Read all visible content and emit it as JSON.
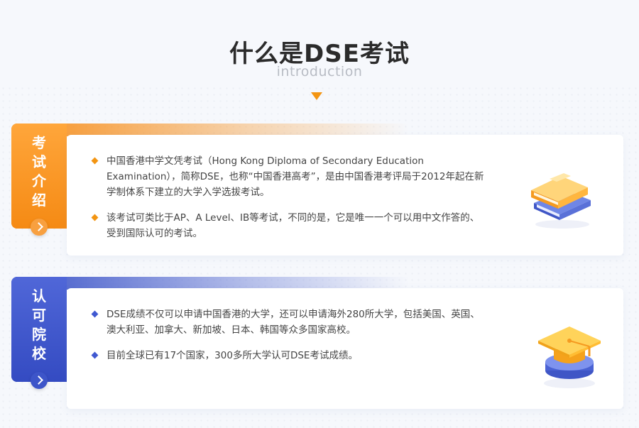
{
  "header": {
    "title": "什么是DSE考试",
    "subtitle": "introduction"
  },
  "sections": [
    {
      "tab_chars": [
        "考",
        "试",
        "介",
        "绍"
      ],
      "bullets": [
        "中国香港中学文凭考试（Hong Kong Diploma of Secondary Education Examination），简称DSE，也称“中国香港高考”，是由中国香港考评局于2012年起在新学制体系下建立的大学入学选拔考试。",
        "该考试可类比于AP、A Level、IB等考试，不同的是，它是唯一一个可以用中文作答的、受到国际认可的考试。"
      ],
      "accent": "#f39512",
      "icon": "books-icon"
    },
    {
      "tab_chars": [
        "认",
        "可",
        "院",
        "校"
      ],
      "bullets": [
        "DSE成绩不仅可以申请中国香港的大学，还可以申请海外280所大学，包括美国、英国、澳大利亚、加拿大、新加坡、日本、韩国等众多国家高校。",
        "目前全球已有17个国家，300多所大学认可DSE考试成绩。"
      ],
      "accent": "#3d55c9",
      "icon": "graduation-cap-icon"
    }
  ]
}
